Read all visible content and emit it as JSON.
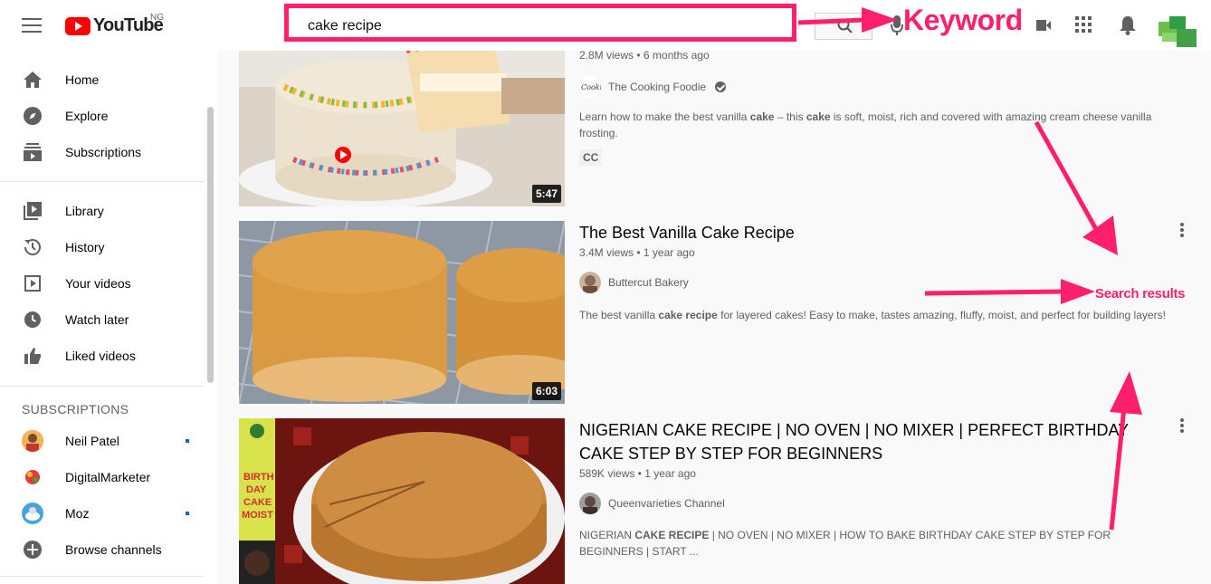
{
  "header": {
    "logo_text": "YouTube",
    "country": "NG",
    "search_value": "cake recipe",
    "search_placeholder": "Search"
  },
  "annotations": {
    "keyword": "Keyword",
    "search_results": "Search results",
    "color": "#ff1f6b"
  },
  "sidebar": {
    "nav": [
      {
        "label": "Home",
        "icon": "home-icon"
      },
      {
        "label": "Explore",
        "icon": "compass-icon"
      },
      {
        "label": "Subscriptions",
        "icon": "subscriptions-icon"
      },
      {
        "label": "Library",
        "icon": "library-icon"
      },
      {
        "label": "History",
        "icon": "history-icon"
      },
      {
        "label": "Your videos",
        "icon": "play-square-icon"
      },
      {
        "label": "Watch later",
        "icon": "clock-icon"
      },
      {
        "label": "Liked videos",
        "icon": "thumbs-up-icon"
      }
    ],
    "subscriptions_header": "SUBSCRIPTIONS",
    "subscriptions": [
      {
        "label": "Neil Patel",
        "new": true
      },
      {
        "label": "DigitalMarketer",
        "new": false
      },
      {
        "label": "Moz",
        "new": true
      },
      {
        "label": "Browse channels",
        "new": false
      }
    ]
  },
  "results": [
    {
      "title": "",
      "views": "2.8M views",
      "age": "6 months ago",
      "channel": "The Cooking Foodie",
      "verified": true,
      "desc_parts": [
        "Learn how to make the best vanilla ",
        "cake",
        " – this ",
        "cake",
        " is soft, moist, rich and covered with amazing cream cheese vanilla frosting."
      ],
      "badge": "CC",
      "duration": "5:47"
    },
    {
      "title": "The Best Vanilla Cake Recipe",
      "views": "3.4M views",
      "age": "1 year ago",
      "channel": "Buttercut Bakery",
      "desc_parts": [
        "The best vanilla ",
        "cake recipe",
        " for layered cakes! Easy to make, tastes amazing, fluffy, moist, and perfect for building layers!"
      ],
      "duration": "6:03"
    },
    {
      "title": "NIGERIAN CAKE RECIPE | NO OVEN | NO MIXER | PERFECT BIRTHDAY CAKE STEP BY STEP FOR BEGINNERS",
      "views": "589K views",
      "age": "1 year ago",
      "channel": "Queenvarieties Channel",
      "desc_parts": [
        "NIGERIAN ",
        "CAKE RECIPE",
        " | NO OVEN | NO MIXER | HOW TO BAKE BIRTHDAY CAKE STEP BY STEP FOR BEGINNERS | START ..."
      ],
      "thumb_text": "BIRTH DAY CAKE MOIST"
    }
  ]
}
